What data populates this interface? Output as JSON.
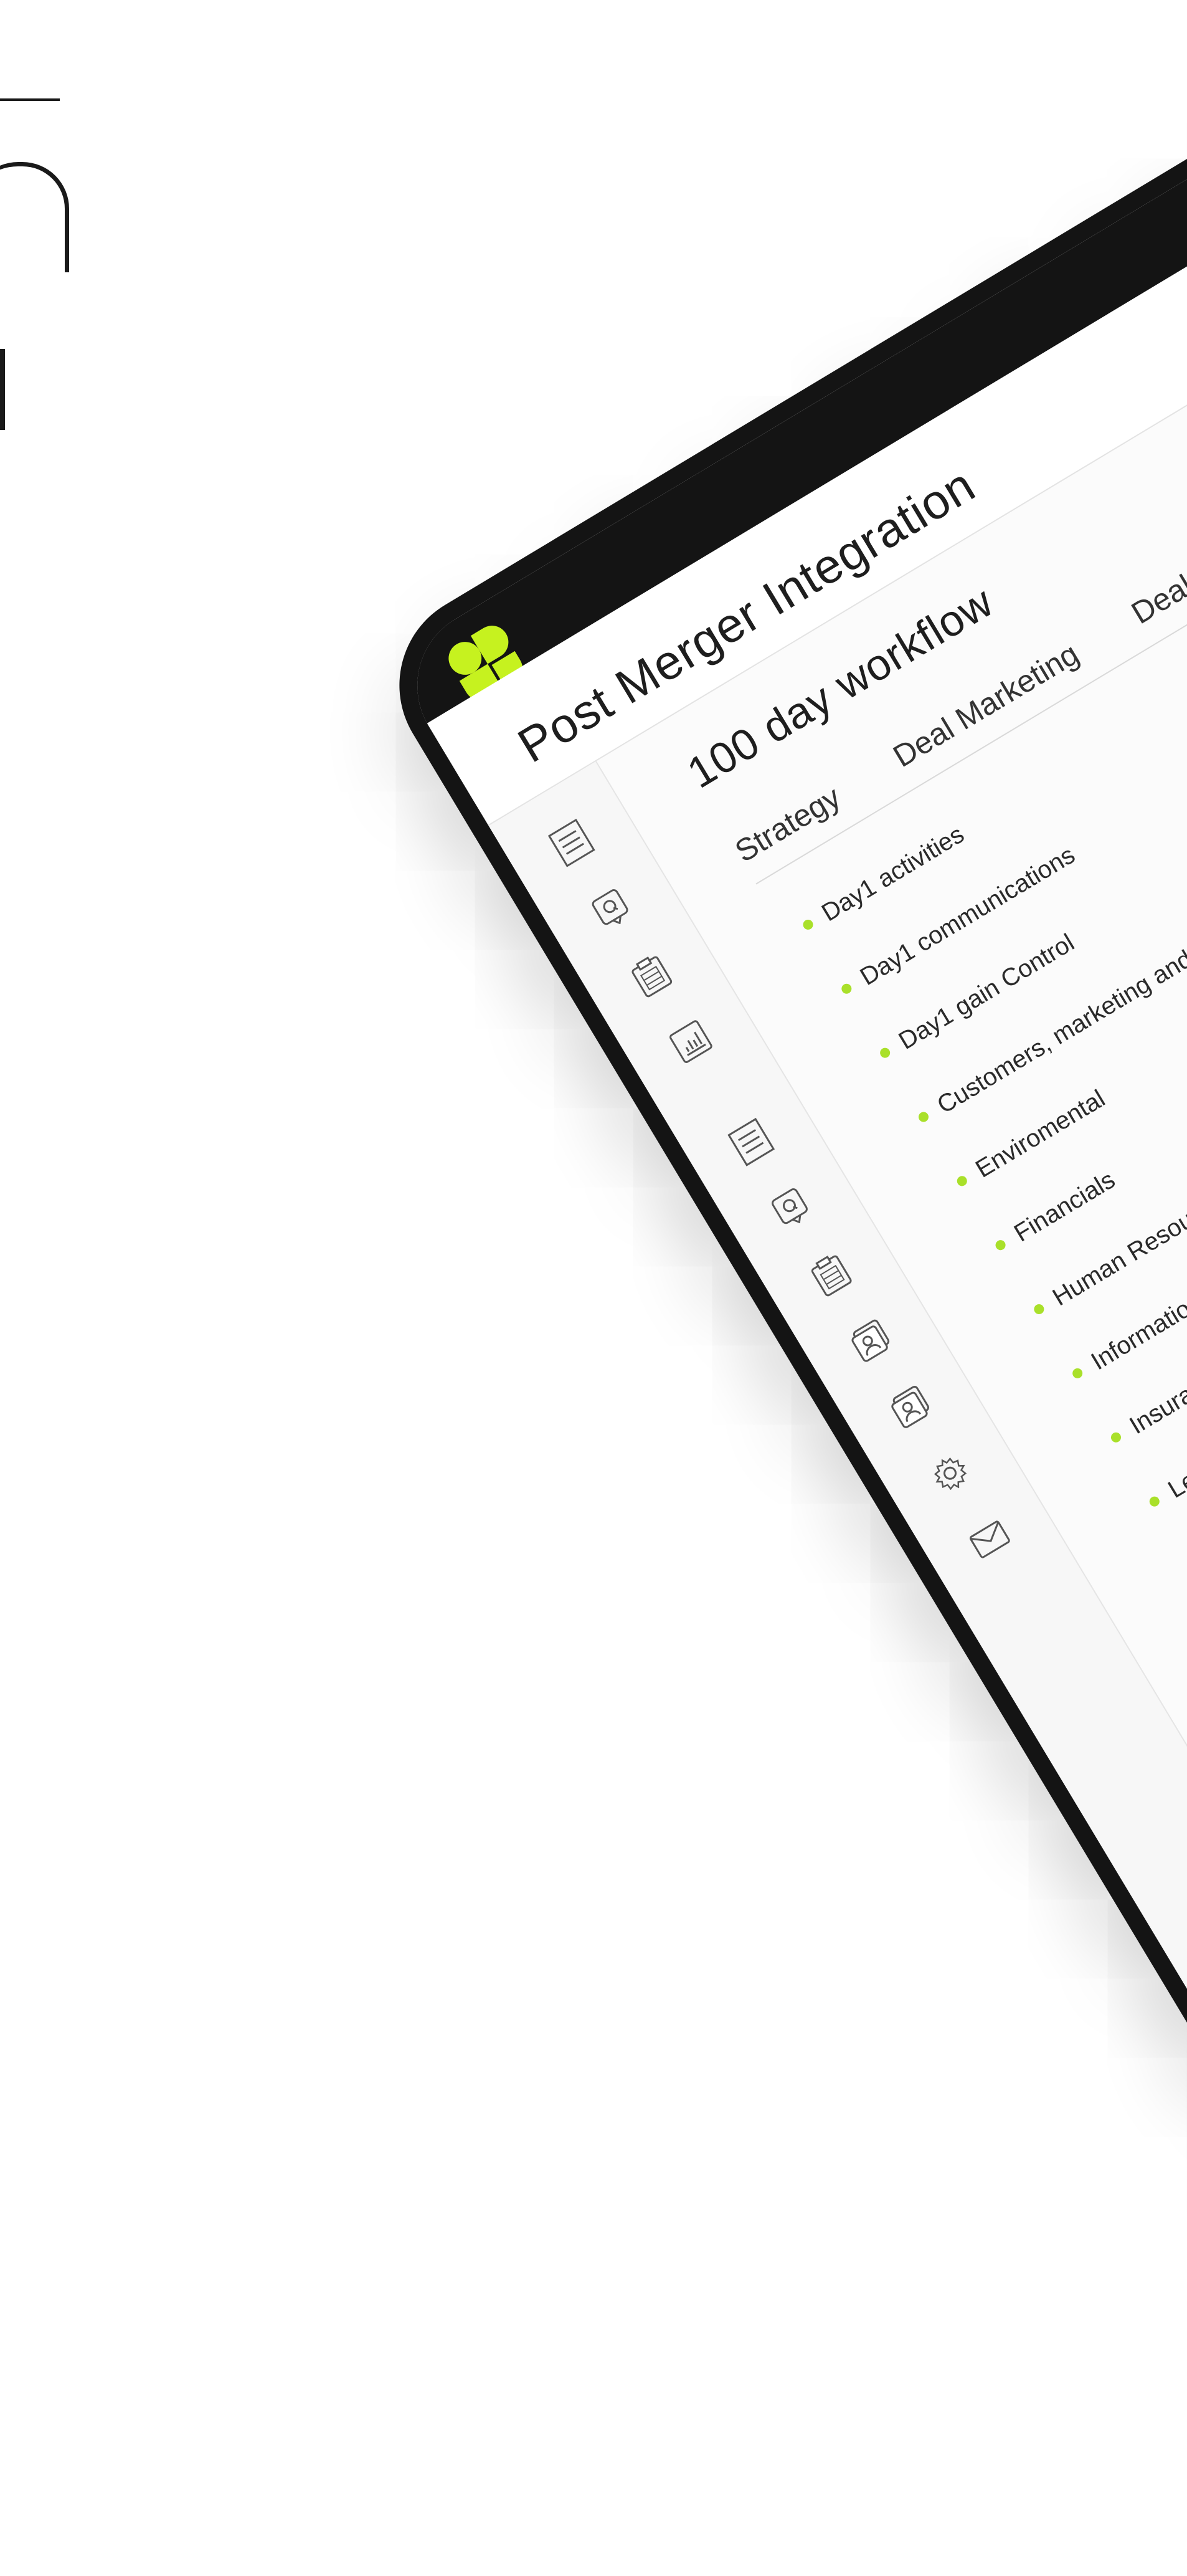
{
  "app": {
    "title": "Post Merger Integration",
    "accent_color": "#a9e02a",
    "logo_icon": "clover-logo-icon"
  },
  "page": {
    "title": "100 day workflow",
    "tabs": [
      {
        "label": "Strategy"
      },
      {
        "label": "Deal Marketing"
      },
      {
        "label": "Deal Preparation"
      }
    ],
    "items": [
      {
        "label": "Day1 activities"
      },
      {
        "label": "Day1 communications"
      },
      {
        "label": "Day1 gain Control"
      },
      {
        "label": "Customers, marketing and sales"
      },
      {
        "label": "Enviromental"
      },
      {
        "label": "Financials"
      },
      {
        "label": "Human Resources"
      },
      {
        "label": "Information Technology"
      },
      {
        "label": "Insurance"
      },
      {
        "label": "Legal"
      }
    ]
  },
  "sidebar": {
    "icons": [
      "document-icon",
      "chat-q-icon",
      "clipboard-icon",
      "chart-icon",
      "document-icon",
      "chat-q-icon",
      "clipboard-icon",
      "contact-card-icon",
      "contact-card-icon",
      "gear-icon",
      "mail-icon"
    ]
  }
}
